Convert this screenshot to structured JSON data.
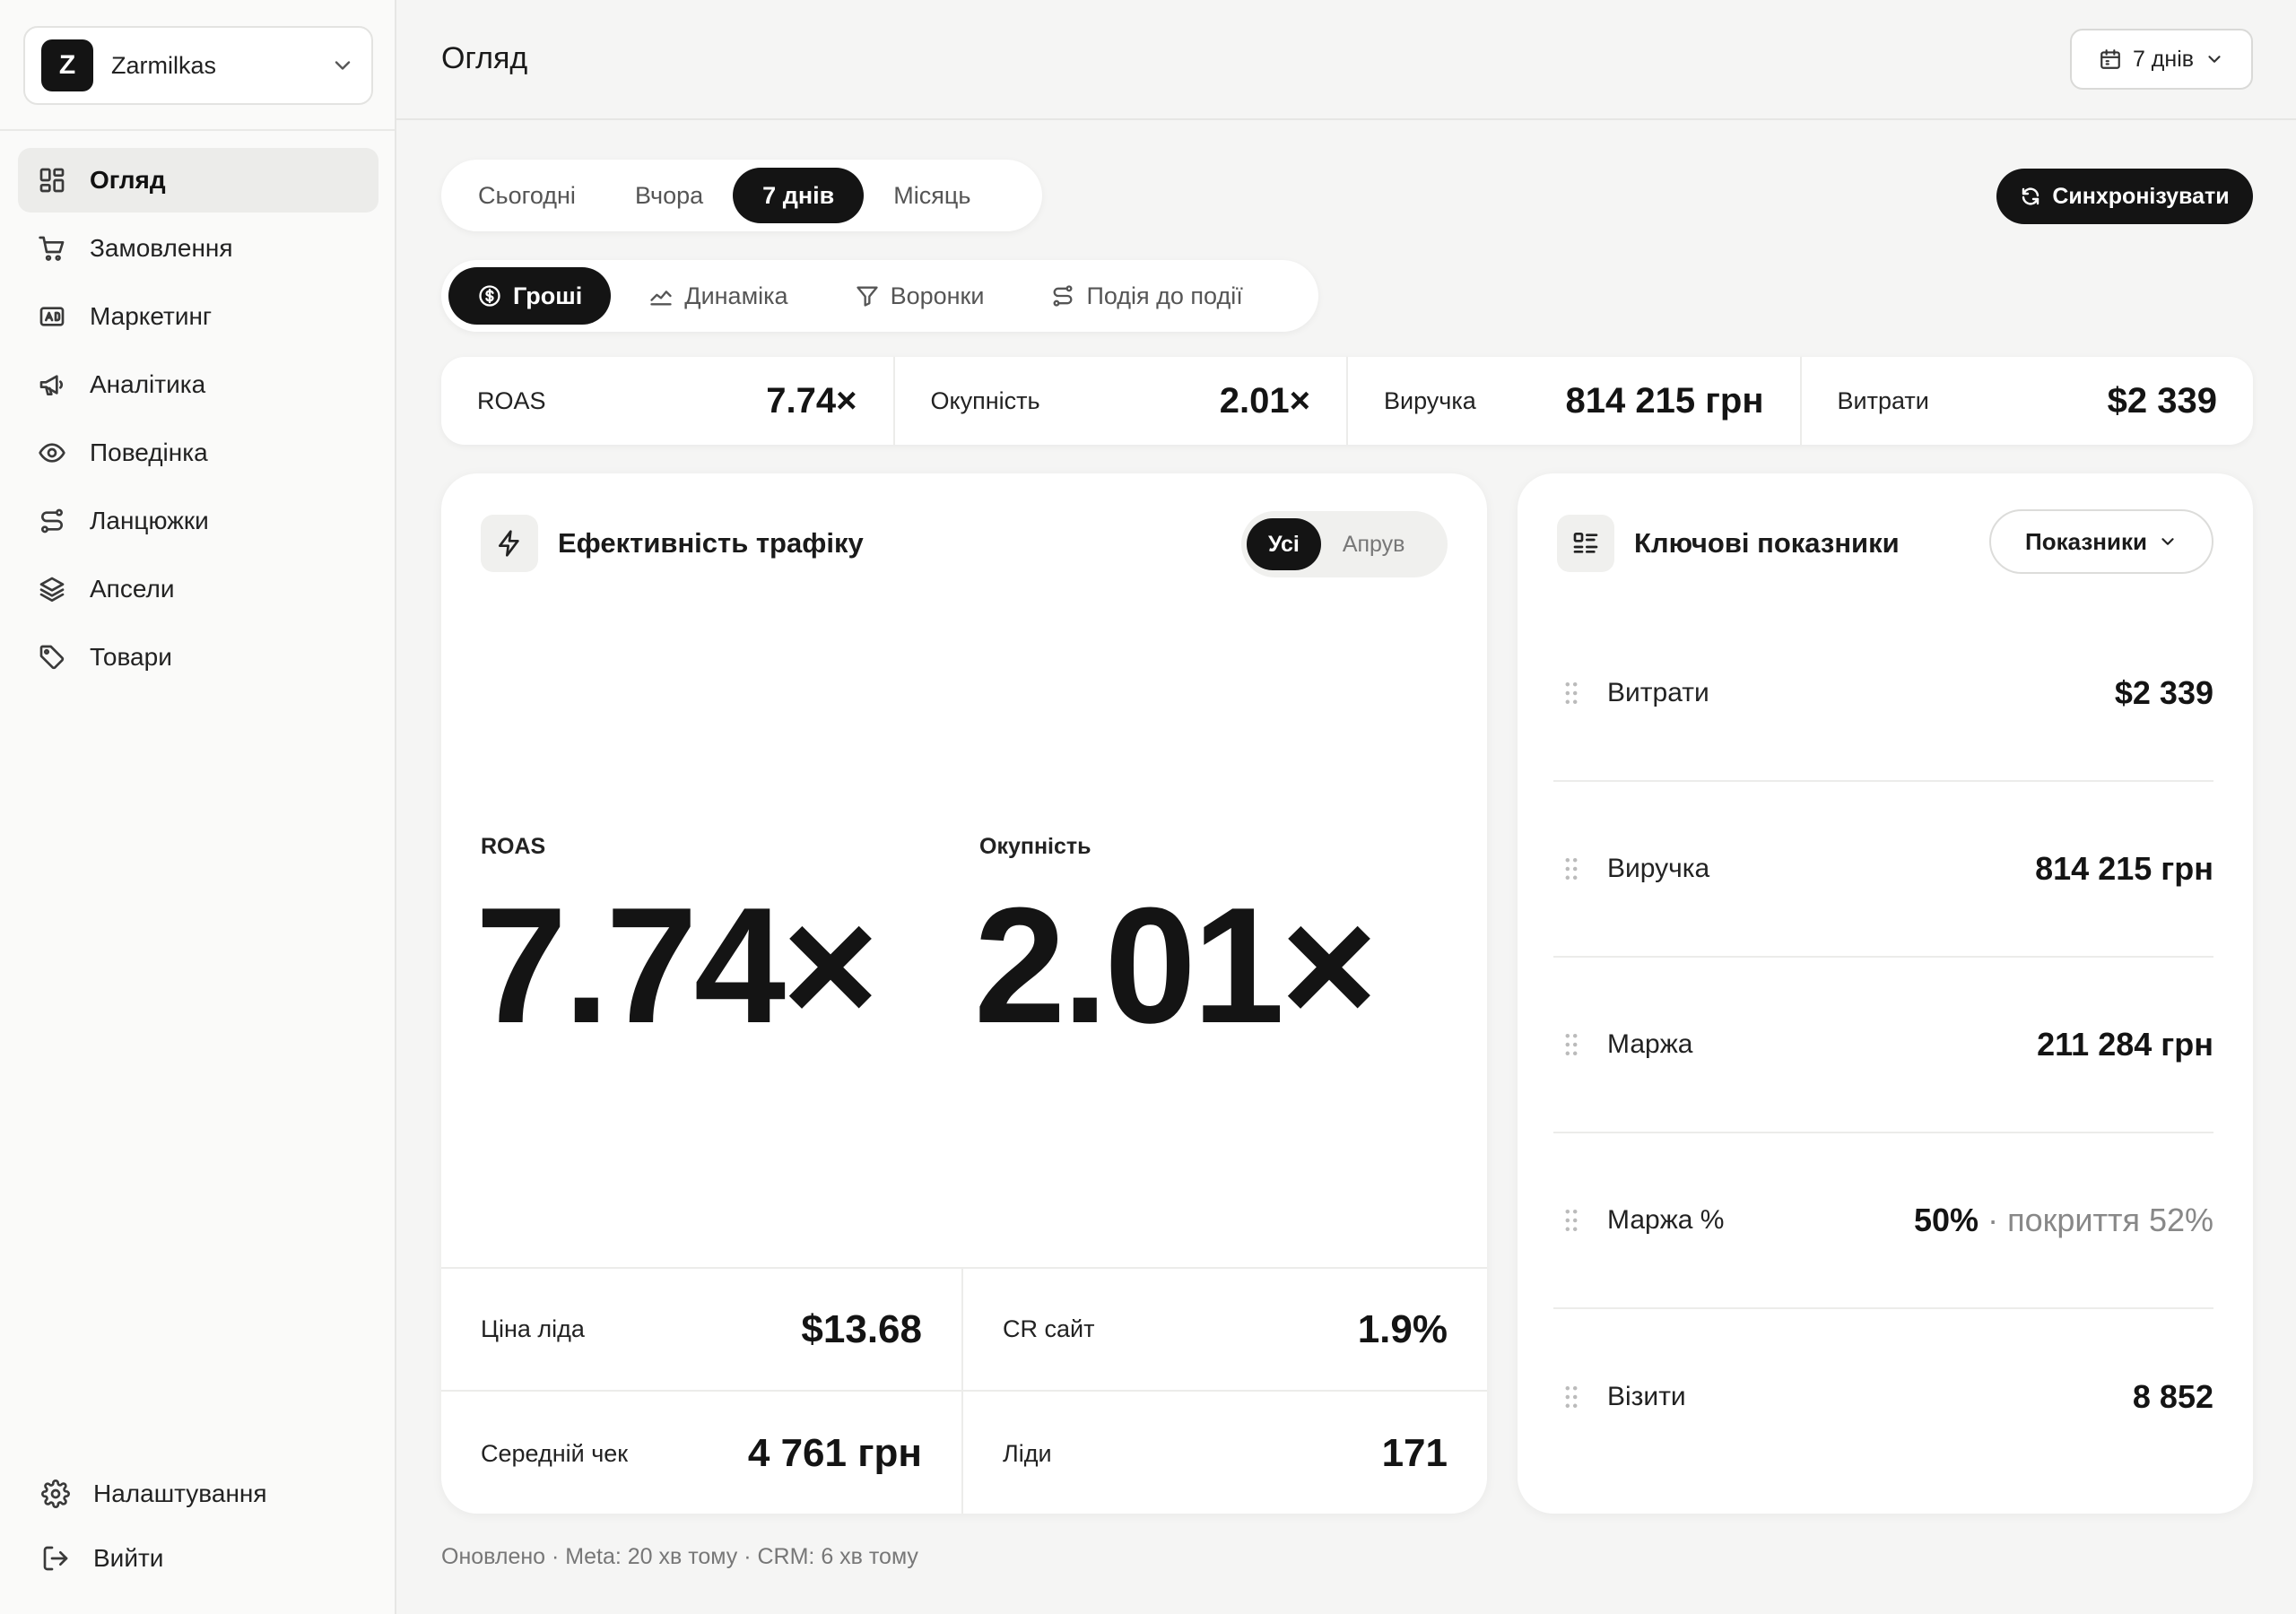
{
  "workspace": {
    "initial": "Z",
    "name": "Zarmilkas"
  },
  "nav": [
    {
      "label": "Огляд",
      "icon": "dashboard-grid-icon",
      "active": true
    },
    {
      "label": "Замовлення",
      "icon": "cart-icon",
      "active": false
    },
    {
      "label": "Маркетинг",
      "icon": "ad-icon",
      "active": false
    },
    {
      "label": "Аналітика",
      "icon": "megaphone-icon",
      "active": false
    },
    {
      "label": "Поведінка",
      "icon": "eye-icon",
      "active": false
    },
    {
      "label": "Ланцюжки",
      "icon": "route-icon",
      "active": false
    },
    {
      "label": "Апсели",
      "icon": "layers-icon",
      "active": false
    },
    {
      "label": "Товари",
      "icon": "tag-icon",
      "active": false
    }
  ],
  "nav_bottom": [
    {
      "label": "Налаштування",
      "icon": "gear-icon"
    },
    {
      "label": "Вийти",
      "icon": "logout-icon"
    }
  ],
  "header": {
    "title": "Огляд",
    "range_label": "7 днів"
  },
  "period_tabs": [
    {
      "label": "Сьогодні",
      "active": false
    },
    {
      "label": "Вчора",
      "active": false
    },
    {
      "label": "7 днів",
      "active": true
    },
    {
      "label": "Місяць",
      "active": false
    }
  ],
  "sync_label": "Синхронізувати",
  "view_tabs": [
    {
      "label": "Гроші",
      "icon": "dollar-circle-icon",
      "active": true
    },
    {
      "label": "Динаміка",
      "icon": "area-chart-icon",
      "active": false
    },
    {
      "label": "Воронки",
      "icon": "funnel-icon",
      "active": false
    },
    {
      "label": "Подія до події",
      "icon": "route-icon",
      "active": false
    }
  ],
  "strip": [
    {
      "label": "ROAS",
      "value": "7.74×"
    },
    {
      "label": "Окупність",
      "value": "2.01×"
    },
    {
      "label": "Виручка",
      "value": "814 215 грн"
    },
    {
      "label": "Витрати",
      "value": "$2 339"
    }
  ],
  "traffic": {
    "title": "Ефективність трафіку",
    "segments": [
      {
        "label": "Усі",
        "active": true
      },
      {
        "label": "Апрув",
        "active": false
      }
    ],
    "big": [
      {
        "label": "ROAS",
        "value": "7.74×"
      },
      {
        "label": "Окупність",
        "value": "2.01×"
      }
    ],
    "grid": [
      {
        "label": "Ціна ліда",
        "value": "$13.68"
      },
      {
        "label": "CR сайт",
        "value": "1.9%"
      },
      {
        "label": "Середній чек",
        "value": "4 761 грн"
      },
      {
        "label": "Ліди",
        "value": "171"
      }
    ]
  },
  "key": {
    "title": "Ключові показники",
    "button_label": "Показники",
    "rows": [
      {
        "label": "Витрати",
        "value": "$2 339",
        "sub": ""
      },
      {
        "label": "Виручка",
        "value": "814 215 грн",
        "sub": ""
      },
      {
        "label": "Маржа",
        "value": "211 284 грн",
        "sub": ""
      },
      {
        "label": "Маржа %",
        "value": "50%",
        "sub": " · покриття 52%"
      },
      {
        "label": "Візити",
        "value": "8 852",
        "sub": ""
      }
    ]
  },
  "footer_note": "Оновлено · Meta: 20 хв тому · CRM: 6 хв тому"
}
